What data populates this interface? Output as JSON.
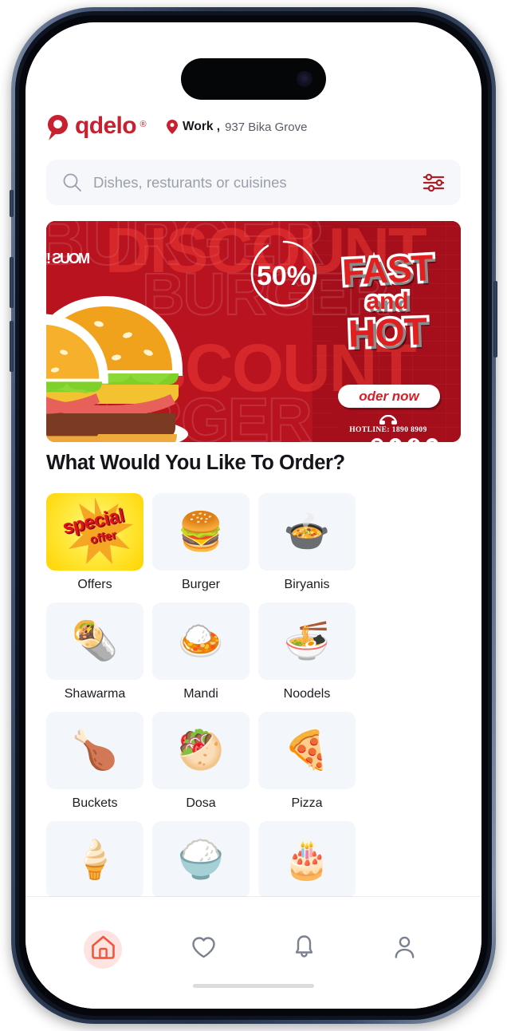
{
  "brand": {
    "name": "qdelo",
    "registered_mark": "®",
    "accent_color": "#c8202f",
    "logo_icon": "location-pin-icon"
  },
  "header": {
    "address_label": "Work ,",
    "address_value": "937 Bika Grove",
    "address_icon": "map-pin-icon"
  },
  "search": {
    "placeholder": "Dishes, resturants or cuisines",
    "value": "",
    "search_icon": "search-icon",
    "filter_icon": "filter-sliders-icon"
  },
  "banner": {
    "discount": "50%",
    "headline_line1": "FAST",
    "headline_line2": "and",
    "headline_line3": "HOT",
    "cta": "oder now",
    "hotline": "HOTLINE: 1890 8909",
    "hotline_icon": "phone-icon",
    "background_words": [
      "BURGER",
      "DISCOUNT",
      "BURGER",
      "DISCOUNT",
      "BURGER"
    ],
    "corner_text": "MOUS !!!",
    "socials": [
      {
        "name": "pinterest-icon",
        "glyph": "P"
      },
      {
        "name": "twitter-icon",
        "glyph": "t"
      },
      {
        "name": "facebook-icon",
        "glyph": "f"
      },
      {
        "name": "instagram-icon",
        "glyph": "◉"
      }
    ],
    "bg_color": "#b8131f",
    "panel_color": "#a50f1b",
    "text_color": "#e02020"
  },
  "main": {
    "section_title": "What Would You Like To Order?",
    "categories": [
      {
        "label": "Offers",
        "icon": "special-offer-star-icon",
        "emoji": "",
        "special": true,
        "badge_line1": "special",
        "badge_line2": "offer"
      },
      {
        "label": "Burger",
        "icon": "burger-icon",
        "emoji": "🍔"
      },
      {
        "label": "Biryanis",
        "icon": "biryani-bowl-icon",
        "emoji": "🍲"
      },
      {
        "label": "Shawarma",
        "icon": "shawarma-icon",
        "emoji": "🌯"
      },
      {
        "label": "Mandi",
        "icon": "mandi-plate-icon",
        "emoji": "🍛"
      },
      {
        "label": "Noodels",
        "icon": "noodles-bowl-icon",
        "emoji": "🍜"
      },
      {
        "label": "Buckets",
        "icon": "chicken-bucket-icon",
        "emoji": "🍗"
      },
      {
        "label": "Dosa",
        "icon": "dosa-plate-icon",
        "emoji": "🥙"
      },
      {
        "label": "Pizza",
        "icon": "pizza-icon",
        "emoji": "🍕"
      },
      {
        "label": "Ice Cream",
        "icon": "ice-cream-cone-icon",
        "emoji": "🍦"
      },
      {
        "label": "Fried Rice",
        "icon": "fried-rice-bowl-icon",
        "emoji": "🍚"
      },
      {
        "label": "Cakes",
        "icon": "birthday-cake-icon",
        "emoji": "🎂"
      }
    ]
  },
  "bottom_nav": {
    "active_index": 0,
    "active_color": "#f0563c",
    "inactive_color": "#7b8090",
    "items": [
      {
        "name": "nav-home",
        "icon": "home-icon",
        "label": ""
      },
      {
        "name": "nav-favorites",
        "icon": "heart-icon",
        "label": ""
      },
      {
        "name": "nav-notifications",
        "icon": "bell-icon",
        "label": ""
      },
      {
        "name": "nav-profile",
        "icon": "person-icon",
        "label": ""
      }
    ]
  }
}
